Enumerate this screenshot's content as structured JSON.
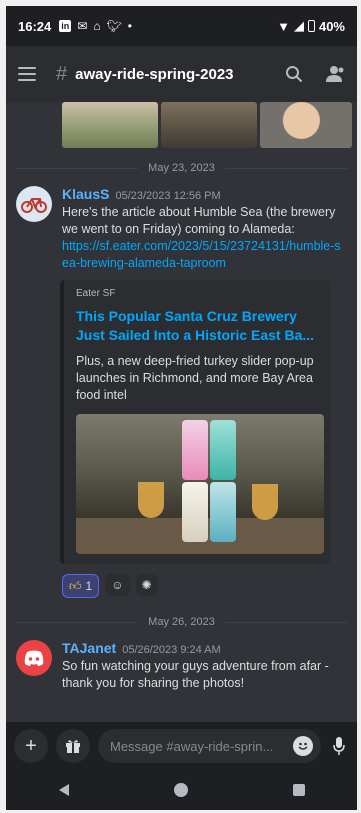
{
  "status_bar": {
    "time": "16:24",
    "battery": "40%",
    "notification_icons": [
      "linkedin-icon",
      "gmail-icon",
      "airbnb-icon",
      "twitter-icon",
      "dot-icon"
    ]
  },
  "header": {
    "hash": "#",
    "channel_name": "away-ride-spring-2023"
  },
  "dividers": {
    "first": "May 23, 2023",
    "second": "May 26, 2023"
  },
  "messages": [
    {
      "author": "KlausS",
      "timestamp": "05/23/2023 12:56 PM",
      "text": "Here's the article about Humble Sea (the brewery we went to on Friday) coming to Alameda:",
      "link": "https://sf.eater.com/2023/5/15/23724131/humble-sea-brewing-alameda-taproom",
      "embed": {
        "provider": "Eater SF",
        "title": "This Popular Santa Cruz Brewery Just Sailed Into a Historic East Ba...",
        "description": "Plus, a new deep-fried turkey slider pop-up launches in Richmond, and more Bay Area food intel"
      },
      "reactions": [
        {
          "emoji": "thumbs-up-icon",
          "count": "1"
        },
        {
          "emoji": "add-reaction-icon",
          "count": ""
        },
        {
          "emoji": "add-super-reaction-icon",
          "count": ""
        }
      ]
    },
    {
      "author": "TAJanet",
      "timestamp": "05/26/2023 9:24 AM",
      "text": "So fun watching your guys adventure from afar - thank you for sharing the photos!"
    }
  ],
  "composer": {
    "placeholder": "Message #away-ride-sprin..."
  },
  "colors": {
    "background": "#313338",
    "accent_link": "#00a8fc",
    "author_name": "#5ab3ff",
    "discord_red": "#ed4245"
  }
}
